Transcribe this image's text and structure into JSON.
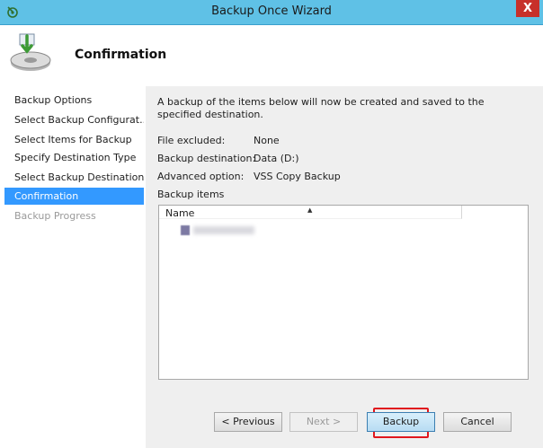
{
  "window": {
    "title": "Backup Once Wizard",
    "close_label": "X"
  },
  "header": {
    "title": "Confirmation",
    "icon": "backup-wizard-icon"
  },
  "nav": {
    "items": [
      {
        "label": "Backup Options",
        "state": "normal"
      },
      {
        "label": "Select Backup Configurat...",
        "state": "normal"
      },
      {
        "label": "Select Items for Backup",
        "state": "normal"
      },
      {
        "label": "Specify Destination Type",
        "state": "normal"
      },
      {
        "label": "Select Backup Destination",
        "state": "normal"
      },
      {
        "label": "Confirmation",
        "state": "active"
      },
      {
        "label": "Backup Progress",
        "state": "disabled"
      }
    ]
  },
  "main": {
    "intro": "A backup of the items below will now be created and saved to the specified destination.",
    "rows": [
      {
        "label": "File excluded:",
        "value": "None"
      },
      {
        "label": "Backup destination:",
        "value": "Data (D:)"
      },
      {
        "label": "Advanced option:",
        "value": "VSS Copy Backup"
      }
    ],
    "items_heading": "Backup items",
    "list": {
      "column_name": "Name",
      "sort_icon": "sort-ascending-icon"
    }
  },
  "buttons": {
    "previous": "< Previous",
    "next": "Next >",
    "backup": "Backup",
    "cancel": "Cancel"
  },
  "colors": {
    "titlebar": "#5fc1e6",
    "close": "#c7302a",
    "nav_active": "#3399ff",
    "highlight": "#e0161d"
  }
}
